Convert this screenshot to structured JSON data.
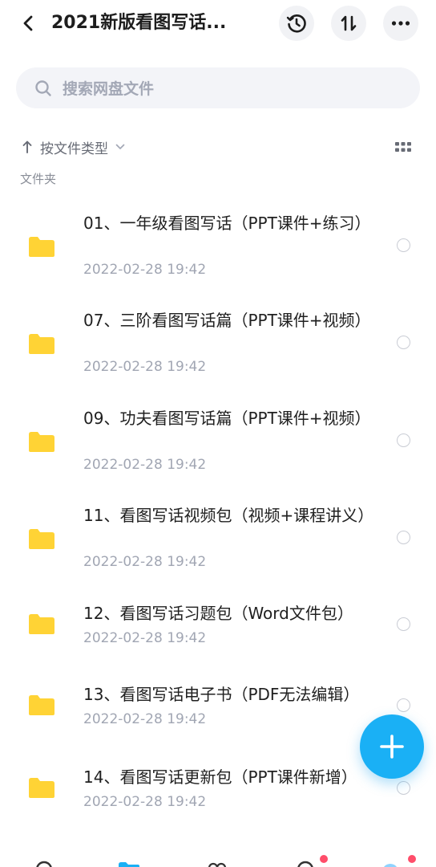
{
  "header": {
    "title": "2021新版看图写话...",
    "back_icon": "chevron-left-icon",
    "history_icon": "history-clock-icon",
    "sort_icon": "sort-arrows-icon",
    "more_icon": "more-dots-icon"
  },
  "search": {
    "placeholder": "搜索网盘文件",
    "icon": "search-icon"
  },
  "sort": {
    "label": "按文件类型",
    "view_icon": "grid-view-icon"
  },
  "section": {
    "label": "文件夹"
  },
  "files": [
    {
      "name": "01、一年级看图写话（PPT课件+练习）",
      "date": "2022-02-28  19:42"
    },
    {
      "name": "07、三阶看图写话篇（PPT课件+视频）",
      "date": "2022-02-28  19:42"
    },
    {
      "name": "09、功夫看图写话篇（PPT课件+视频）",
      "date": "2022-02-28  19:42"
    },
    {
      "name": "11、看图写话视频包（视频+课程讲义）",
      "date": "2022-02-28  19:42"
    },
    {
      "name": "12、看图写话习题包（Word文件包）",
      "date": "2022-02-28  19:42"
    },
    {
      "name": "13、看图写话电子书（PDF无法编辑）",
      "date": "2022-02-28  19:42"
    },
    {
      "name": "14、看图写话更新包（PPT课件新增）",
      "date": "2022-02-28  19:42"
    }
  ],
  "fab": {
    "icon": "plus-icon"
  },
  "colors": {
    "accent": "#1ab0f5",
    "folder": "#ffd335",
    "badge": "#ff4d6a"
  }
}
